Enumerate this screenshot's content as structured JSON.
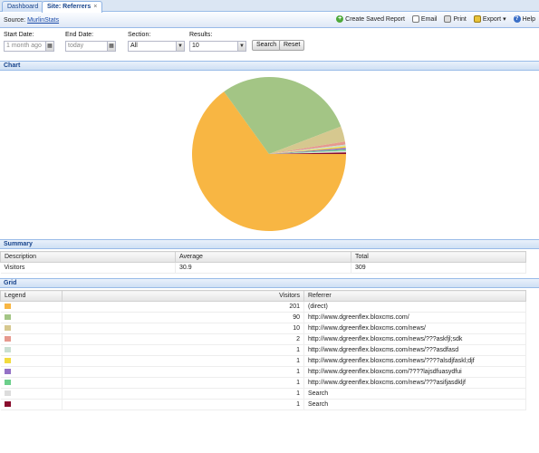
{
  "tabs": [
    {
      "label": "Dashboard",
      "active": false
    },
    {
      "label": "Site: Referrers",
      "active": true,
      "close": "×"
    }
  ],
  "toolbar": {
    "source_prefix": "Source:",
    "source_link": "MurlinStats",
    "actions": [
      {
        "label": "Create Saved Report",
        "icon": "plus-icon"
      },
      {
        "label": "Email",
        "icon": "email-icon"
      },
      {
        "label": "Print",
        "icon": "print-icon"
      },
      {
        "label": "Export",
        "icon": "export-icon",
        "dropdown": "▾"
      },
      {
        "label": "Help",
        "icon": "help-icon"
      }
    ]
  },
  "filters": {
    "start_date": {
      "label": "Start Date:",
      "value": "1 month ago"
    },
    "end_date": {
      "label": "End Date:",
      "value": "today"
    },
    "section": {
      "label": "Section:",
      "value": "All"
    },
    "results": {
      "label": "Results:",
      "value": "10"
    },
    "search_button": "Search",
    "reset_button": "Reset"
  },
  "panels": {
    "chart": "Chart",
    "summary": "Summary",
    "grid": "Grid"
  },
  "chart_data": {
    "type": "pie",
    "values": [
      201,
      90,
      10,
      2,
      1,
      1,
      1,
      1,
      1,
      1
    ],
    "categories": [
      "(direct)",
      "http://www.dgreenflex.bloxcms.com/",
      "http://www.dgreenflex.bloxcms.com/news/",
      "http://www.dgreenflex.bloxcms.com/news/???askfjl;sdk",
      "http://www.dgreenflex.bloxcms.com/news/???asdfasd",
      "http://www.dgreenflex.bloxcms.com/news/????alsdjfaskl;djf",
      "http://www.dgreenflex.bloxcms.com/????lajsdfuasydfui",
      "http://www.dgreenflex.bloxcms.com/news/???asifjasdkljf",
      "Search",
      "Search"
    ],
    "colors": [
      "#f8b643",
      "#a3c585",
      "#d6c88f",
      "#e6998e",
      "#c9dfd2",
      "#f2db3e",
      "#9471c6",
      "#6ccf8b",
      "#dcdcdc",
      "#8a0e2e"
    ]
  },
  "summary": {
    "headers": [
      "Description",
      "Average",
      "Total"
    ],
    "rows": [
      [
        "Visitors",
        "30.9",
        "309"
      ]
    ]
  },
  "grid": {
    "headers": [
      "Legend",
      "Visitors",
      "Referrer"
    ],
    "rows": [
      {
        "color": "#f8b643",
        "visitors": "201",
        "referrer": "(direct)"
      },
      {
        "color": "#a3c585",
        "visitors": "90",
        "referrer": "http://www.dgreenflex.bloxcms.com/"
      },
      {
        "color": "#d6c88f",
        "visitors": "10",
        "referrer": "http://www.dgreenflex.bloxcms.com/news/"
      },
      {
        "color": "#e6998e",
        "visitors": "2",
        "referrer": "http://www.dgreenflex.bloxcms.com/news/???askfjl;sdk"
      },
      {
        "color": "#c9dfd2",
        "visitors": "1",
        "referrer": "http://www.dgreenflex.bloxcms.com/news/???asdfasd"
      },
      {
        "color": "#f2db3e",
        "visitors": "1",
        "referrer": "http://www.dgreenflex.bloxcms.com/news/????alsdjfaskl;djf"
      },
      {
        "color": "#9471c6",
        "visitors": "1",
        "referrer": "http://www.dgreenflex.bloxcms.com/????lajsdfuasydfui"
      },
      {
        "color": "#6ccf8b",
        "visitors": "1",
        "referrer": "http://www.dgreenflex.bloxcms.com/news/???asifjasdkljf"
      },
      {
        "color": "#dcdcdc",
        "visitors": "1",
        "referrer": "Search"
      },
      {
        "color": "#8a0e2e",
        "visitors": "1",
        "referrer": "Search"
      }
    ]
  }
}
